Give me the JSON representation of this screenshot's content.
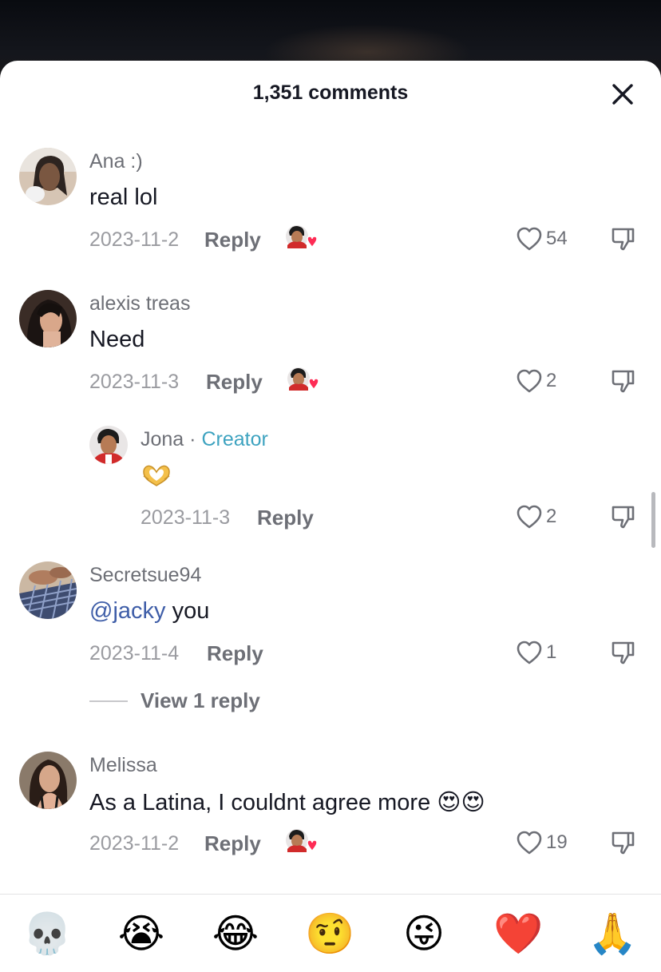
{
  "sheet": {
    "title": "1,351 comments"
  },
  "comments": [
    {
      "username": "Ana :)",
      "text": "real lol",
      "date": "2023-11-2",
      "reply_label": "Reply",
      "likes": "54",
      "creator_liked": true
    },
    {
      "username": "alexis treas",
      "text": "Need",
      "date": "2023-11-3",
      "reply_label": "Reply",
      "likes": "2",
      "creator_liked": true,
      "replies": [
        {
          "username": "Jona",
          "separator": "·",
          "badge": "Creator",
          "text_icon": "heart-hands-emoji",
          "date": "2023-11-3",
          "reply_label": "Reply",
          "likes": "2"
        }
      ]
    },
    {
      "username": "Secretsue94",
      "mention": "@jacky",
      "text": " you",
      "date": "2023-11-4",
      "reply_label": "Reply",
      "likes": "1",
      "view_replies": "View 1 reply"
    },
    {
      "username": "Melissa",
      "text": "As a Latina, I couldnt agree more",
      "text_emojis": "😍😍",
      "date": "2023-11-2",
      "reply_label": "Reply",
      "likes": "19",
      "creator_liked": true
    }
  ],
  "emoji_bar": [
    "💀",
    "😭",
    "😂",
    "🤨",
    "😜",
    "❤️",
    "🙏"
  ],
  "colors": {
    "creator": "#3ea3c0",
    "mention": "#3f5ea8",
    "text": "#161823",
    "muted": "#6d6f76",
    "heart": "#fe2c55"
  }
}
